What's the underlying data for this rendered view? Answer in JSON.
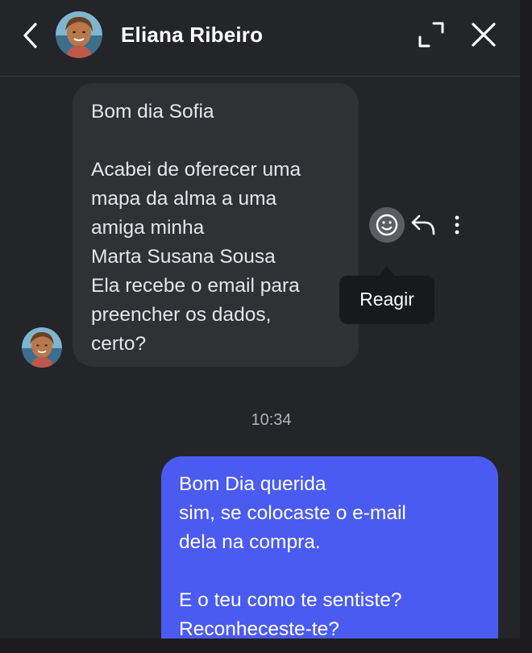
{
  "header": {
    "contact_name": "Eliana Ribeiro",
    "icons": {
      "back": "chevron-left-icon",
      "expand": "expand-icon",
      "close": "close-icon"
    }
  },
  "messages": [
    {
      "direction": "incoming",
      "text": "Bom dia Sofia\n\nAcabei de oferecer uma\nmapa da alma a uma\namiga minha\nMarta Susana Sousa\nEla recebe o email para\npreencher os dados,\ncerto?"
    },
    {
      "direction": "outgoing",
      "text": "Bom Dia querida\nsim, se colocaste o e-mail\ndela na compra.\n\nE o teu como te sentiste?\nReconheceste-te?"
    }
  ],
  "message_actions": {
    "tooltip": "Reagir",
    "icons": {
      "react": "smiley-icon",
      "reply": "reply-icon",
      "more": "more-vertical-icon"
    }
  },
  "timestamp": "10:34",
  "colors": {
    "background": "#242529",
    "incoming_bubble": "#303134",
    "outgoing_bubble": "#4a5bf2",
    "tooltip": "#18191b"
  }
}
